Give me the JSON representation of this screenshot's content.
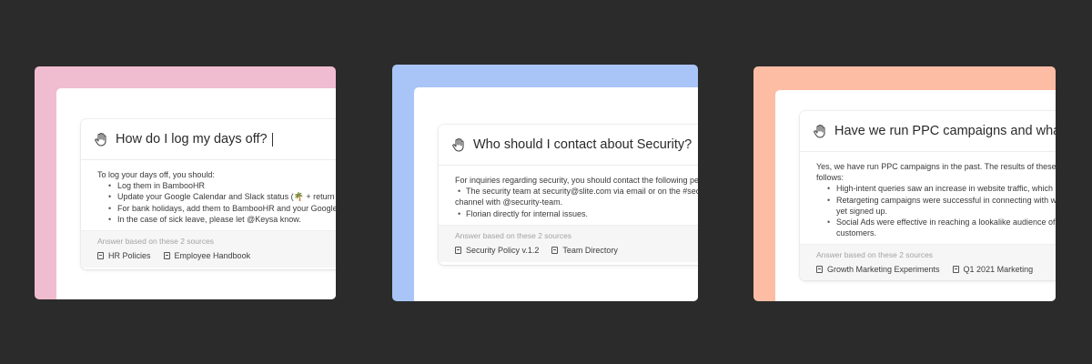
{
  "colors": {
    "background": "#2b2b2b",
    "panel_pink": "#f0bcd0",
    "panel_blue": "#a9c5f7",
    "panel_peach": "#fcbda4"
  },
  "icons": {
    "question": "hand-wave-icon",
    "source": "document-icon"
  },
  "panels": [
    {
      "question": "How do I log my days off?",
      "answer_intro": "To log your days off, you should:",
      "answer_items": [
        "Log them in BambooHR",
        "Update your Google Calendar and Slack status (🌴 + return date).",
        "For bank holidays, add them to BambooHR and your Google calendar.",
        "In the case of sick leave, please let @Keysa know."
      ],
      "sources_label": "Answer based on these 2 sources",
      "sources": [
        "HR Policies",
        "Employee Handbook"
      ]
    },
    {
      "question": "Who should I contact about Security?",
      "answer_intro": "For inquiries regarding security, you should contact the following people:",
      "answer_items": [
        "The security team at security@slite.com via email or on the #security Slack",
        "channel with @security-team.",
        "Florian directly for internal issues."
      ],
      "sources_label": "Answer based on these 2 sources",
      "sources": [
        "Security Policy v.1.2",
        "Team Directory"
      ]
    },
    {
      "question": "Have we run PPC campaigns and what was the re",
      "answer_intro": "Yes, we have run PPC campaigns in the past. The results of these campaigns",
      "answer_intro_2": "follows:",
      "answer_items": [
        "High-intent queries saw an increase in website traffic, which resulted in m",
        "Retargeting campaigns were successful in connecting with website visito",
        "yet signed up.",
        "Social Ads were effective in reaching a lookalike audience of our most act",
        "customers."
      ],
      "sources_label": "Answer based on these 2 sources",
      "sources": [
        "Growth Marketing Experiments",
        "Q1 2021 Marketing"
      ]
    }
  ]
}
